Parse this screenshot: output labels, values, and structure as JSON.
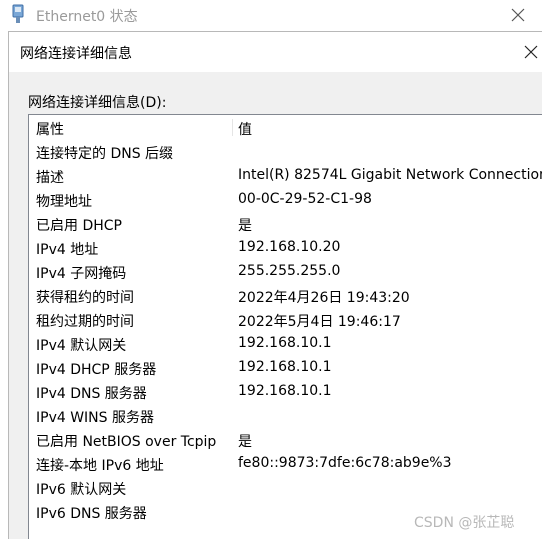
{
  "parent_window": {
    "title": "Ethernet0 状态"
  },
  "dialog": {
    "title": "网络连接详细信息",
    "group_label": "网络连接详细信息(D):"
  },
  "table": {
    "headers": [
      "属性",
      "值"
    ],
    "rows": [
      {
        "prop": "连接特定的 DNS 后缀",
        "value": ""
      },
      {
        "prop": "描述",
        "value": "Intel(R) 82574L Gigabit Network Connection"
      },
      {
        "prop": "物理地址",
        "value": "00-0C-29-52-C1-98"
      },
      {
        "prop": "已启用 DHCP",
        "value": "是"
      },
      {
        "prop": "IPv4 地址",
        "value": "192.168.10.20"
      },
      {
        "prop": "IPv4 子网掩码",
        "value": "255.255.255.0"
      },
      {
        "prop": "获得租约的时间",
        "value": "2022年4月26日 19:43:20"
      },
      {
        "prop": "租约过期的时间",
        "value": "2022年5月4日 19:46:17"
      },
      {
        "prop": "IPv4 默认网关",
        "value": "192.168.10.1"
      },
      {
        "prop": "IPv4 DHCP 服务器",
        "value": "192.168.10.1"
      },
      {
        "prop": "IPv4 DNS 服务器",
        "value": "192.168.10.1"
      },
      {
        "prop": "IPv4 WINS 服务器",
        "value": ""
      },
      {
        "prop": "已启用 NetBIOS over Tcpip",
        "value": "是"
      },
      {
        "prop": "连接-本地 IPv6 地址",
        "value": "fe80::9873:7dfe:6c78:ab9e%3"
      },
      {
        "prop": "IPv6 默认网关",
        "value": ""
      },
      {
        "prop": "IPv6 DNS 服务器",
        "value": ""
      }
    ]
  },
  "watermark": "CSDN @张芷聪",
  "icons": {
    "parent_window": "network-adapter-icon",
    "close": "close-icon"
  }
}
